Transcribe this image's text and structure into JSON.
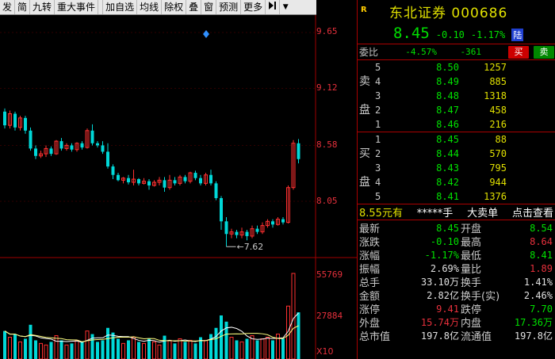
{
  "toolbar": {
    "items": [
      "发",
      "简",
      "九转",
      "重大事件",
      "加自选",
      "均线",
      "除权",
      "叠",
      "窗",
      "预测",
      "更多"
    ],
    "arrow_icon": "flag-arrow-icon",
    "dropdown_icon": "dropdown-icon"
  },
  "chart": {
    "price_axis": [
      "9.65",
      "9.12",
      "8.58",
      "8.05"
    ],
    "low_marker": "7.62",
    "volume_axis": [
      "55769",
      "27884"
    ],
    "volume_unit": "X10",
    "colors": {
      "up": "#ff3030",
      "down": "#00d8d8",
      "ma": "#ffff80",
      "grid": "#a00000"
    }
  },
  "stock": {
    "badge": "R",
    "name": "东北证券",
    "code": "000686",
    "price": "8.45",
    "change": "-0.10",
    "change_pct": "-1.17%",
    "market_badge": "陆"
  },
  "weibi": {
    "label": "委比",
    "pct": "-4.57%",
    "diff": "-361",
    "buy_btn": "买",
    "sell_btn": "卖"
  },
  "sell_side": {
    "label": "卖盘",
    "rows": [
      {
        "lvl": "5",
        "price": "8.50",
        "vol": "1257"
      },
      {
        "lvl": "4",
        "price": "8.49",
        "vol": "885"
      },
      {
        "lvl": "3",
        "price": "8.48",
        "vol": "1318"
      },
      {
        "lvl": "2",
        "price": "8.47",
        "vol": "458"
      },
      {
        "lvl": "1",
        "price": "8.46",
        "vol": "216"
      }
    ]
  },
  "buy_side": {
    "label": "买盘",
    "rows": [
      {
        "lvl": "1",
        "price": "8.45",
        "vol": "88"
      },
      {
        "lvl": "2",
        "price": "8.44",
        "vol": "570"
      },
      {
        "lvl": "3",
        "price": "8.43",
        "vol": "795"
      },
      {
        "lvl": "4",
        "price": "8.42",
        "vol": "944"
      },
      {
        "lvl": "5",
        "price": "8.41",
        "vol": "1376"
      }
    ]
  },
  "ticker": {
    "price": "8.55元有",
    "qty": "*****手",
    "label": "大卖单",
    "link": "点击查看"
  },
  "stats": [
    {
      "l1": "最新",
      "v1": "8.45",
      "c1": "green",
      "l2": "开盘",
      "v2": "8.54",
      "c2": "green"
    },
    {
      "l1": "涨跌",
      "v1": "-0.10",
      "c1": "green",
      "l2": "最高",
      "v2": "8.64",
      "c2": "red"
    },
    {
      "l1": "涨幅",
      "v1": "-1.17%",
      "c1": "green",
      "l2": "最低",
      "v2": "8.41",
      "c2": "green"
    },
    {
      "l1": "振幅",
      "v1": "2.69%",
      "c1": "white",
      "l2": "量比",
      "v2": "1.89",
      "c2": "red"
    },
    {
      "l1": "总手",
      "v1": "33.10万",
      "c1": "white",
      "l2": "换手",
      "v2": "1.41%",
      "c2": "white"
    },
    {
      "l1": "金额",
      "v1": "2.82亿",
      "c1": "white",
      "l2": "换手(实)",
      "v2": "2.46%",
      "c2": "white"
    },
    {
      "l1": "涨停",
      "v1": "9.41",
      "c1": "red",
      "l2": "跌停",
      "v2": "7.70",
      "c2": "green"
    },
    {
      "l1": "外盘",
      "v1": "15.74万",
      "c1": "red",
      "l2": "内盘",
      "v2": "17.36万",
      "c2": "green"
    },
    {
      "l1": "总市值",
      "v1": "197.8亿",
      "c1": "white",
      "l2": "流通值",
      "v2": "197.8亿",
      "c2": "white"
    }
  ],
  "candles": [
    {
      "o": 8.9,
      "c": 8.77,
      "h": 8.93,
      "l": 8.74
    },
    {
      "o": 8.77,
      "c": 8.88,
      "h": 8.91,
      "l": 8.74
    },
    {
      "o": 8.88,
      "c": 8.75,
      "h": 8.9,
      "l": 8.72
    },
    {
      "o": 8.75,
      "c": 8.84,
      "h": 8.86,
      "l": 8.72
    },
    {
      "o": 8.84,
      "c": 8.72,
      "h": 8.86,
      "l": 8.69
    },
    {
      "o": 8.72,
      "c": 8.55,
      "h": 8.75,
      "l": 8.53
    },
    {
      "o": 8.55,
      "c": 8.48,
      "h": 8.58,
      "l": 8.45
    },
    {
      "o": 8.48,
      "c": 8.5,
      "h": 8.53,
      "l": 8.46
    },
    {
      "o": 8.5,
      "c": 8.55,
      "h": 8.58,
      "l": 8.47
    },
    {
      "o": 8.55,
      "c": 8.5,
      "h": 8.57,
      "l": 8.48
    },
    {
      "o": 8.5,
      "c": 8.62,
      "h": 8.63,
      "l": 8.49
    },
    {
      "o": 8.62,
      "c": 8.55,
      "h": 8.65,
      "l": 8.53
    },
    {
      "o": 8.55,
      "c": 8.58,
      "h": 8.6,
      "l": 8.53
    },
    {
      "o": 8.58,
      "c": 8.54,
      "h": 8.6,
      "l": 8.52
    },
    {
      "o": 8.54,
      "c": 8.6,
      "h": 8.61,
      "l": 8.52
    },
    {
      "o": 8.6,
      "c": 8.56,
      "h": 8.62,
      "l": 8.54
    },
    {
      "o": 8.56,
      "c": 8.72,
      "h": 8.74,
      "l": 8.55
    },
    {
      "o": 8.72,
      "c": 8.6,
      "h": 8.78,
      "l": 8.58
    },
    {
      "o": 8.6,
      "c": 8.58,
      "h": 8.62,
      "l": 8.56
    },
    {
      "o": 8.58,
      "c": 8.52,
      "h": 8.62,
      "l": 8.5
    },
    {
      "o": 8.52,
      "c": 8.38,
      "h": 8.6,
      "l": 8.36
    },
    {
      "o": 8.38,
      "c": 8.3,
      "h": 8.4,
      "l": 8.26
    },
    {
      "o": 8.3,
      "c": 8.25,
      "h": 8.32,
      "l": 8.24
    },
    {
      "o": 8.25,
      "c": 8.27,
      "h": 8.28,
      "l": 8.22
    },
    {
      "o": 8.27,
      "c": 8.23,
      "h": 8.3,
      "l": 8.21
    },
    {
      "o": 8.23,
      "c": 8.26,
      "h": 8.35,
      "l": 8.2
    },
    {
      "o": 8.26,
      "c": 8.22,
      "h": 8.27,
      "l": 8.2
    },
    {
      "o": 8.22,
      "c": 8.24,
      "h": 8.27,
      "l": 8.21
    },
    {
      "o": 8.24,
      "c": 8.2,
      "h": 8.26,
      "l": 8.16
    },
    {
      "o": 8.2,
      "c": 8.23,
      "h": 8.25,
      "l": 8.19
    },
    {
      "o": 8.23,
      "c": 8.25,
      "h": 8.28,
      "l": 8.2
    },
    {
      "o": 8.25,
      "c": 8.18,
      "h": 8.28,
      "l": 8.14
    },
    {
      "o": 8.18,
      "c": 8.25,
      "h": 8.3,
      "l": 8.16
    },
    {
      "o": 8.25,
      "c": 8.22,
      "h": 8.28,
      "l": 8.2
    },
    {
      "o": 8.22,
      "c": 8.28,
      "h": 8.3,
      "l": 8.2
    },
    {
      "o": 8.28,
      "c": 8.24,
      "h": 8.3,
      "l": 8.22
    },
    {
      "o": 8.24,
      "c": 8.32,
      "h": 8.33,
      "l": 8.22
    },
    {
      "o": 8.32,
      "c": 8.27,
      "h": 8.34,
      "l": 8.25
    },
    {
      "o": 8.27,
      "c": 8.22,
      "h": 8.3,
      "l": 8.2
    },
    {
      "o": 8.22,
      "c": 8.3,
      "h": 8.32,
      "l": 8.2
    },
    {
      "o": 8.3,
      "c": 8.22,
      "h": 8.35,
      "l": 8.2
    },
    {
      "o": 8.22,
      "c": 8.08,
      "h": 8.24,
      "l": 8.06
    },
    {
      "o": 8.08,
      "c": 7.86,
      "h": 8.1,
      "l": 7.78
    },
    {
      "o": 7.86,
      "c": 7.74,
      "h": 7.9,
      "l": 7.62
    },
    {
      "o": 7.74,
      "c": 7.76,
      "h": 7.79,
      "l": 7.7
    },
    {
      "o": 7.76,
      "c": 7.73,
      "h": 7.78,
      "l": 7.7
    },
    {
      "o": 7.73,
      "c": 7.76,
      "h": 7.8,
      "l": 7.7
    },
    {
      "o": 7.76,
      "c": 7.72,
      "h": 7.78,
      "l": 7.68
    },
    {
      "o": 7.72,
      "c": 7.79,
      "h": 7.82,
      "l": 7.7
    },
    {
      "o": 7.79,
      "c": 7.76,
      "h": 7.82,
      "l": 7.74
    },
    {
      "o": 7.76,
      "c": 7.82,
      "h": 7.85,
      "l": 7.74
    },
    {
      "o": 7.82,
      "c": 7.86,
      "h": 7.88,
      "l": 7.8
    },
    {
      "o": 7.86,
      "c": 7.83,
      "h": 7.88,
      "l": 7.8
    },
    {
      "o": 7.83,
      "c": 7.88,
      "h": 7.9,
      "l": 7.82
    },
    {
      "o": 7.88,
      "c": 7.85,
      "h": 7.9,
      "l": 7.83
    },
    {
      "o": 7.85,
      "c": 8.18,
      "h": 8.2,
      "l": 7.84
    },
    {
      "o": 8.18,
      "c": 8.6,
      "h": 8.63,
      "l": 8.16
    },
    {
      "o": 8.6,
      "c": 8.45,
      "h": 8.64,
      "l": 8.41
    }
  ],
  "volumes": [
    18,
    14,
    16,
    11,
    13,
    22,
    12,
    10,
    9,
    11,
    15,
    12,
    9,
    10,
    12,
    11,
    18,
    16,
    11,
    12,
    20,
    17,
    13,
    10,
    12,
    14,
    11,
    10,
    13,
    11,
    9,
    15,
    12,
    10,
    13,
    11,
    12,
    10,
    14,
    12,
    16,
    20,
    28,
    24,
    14,
    12,
    11,
    13,
    15,
    12,
    13,
    14,
    12,
    16,
    13,
    34,
    55,
    30
  ]
}
